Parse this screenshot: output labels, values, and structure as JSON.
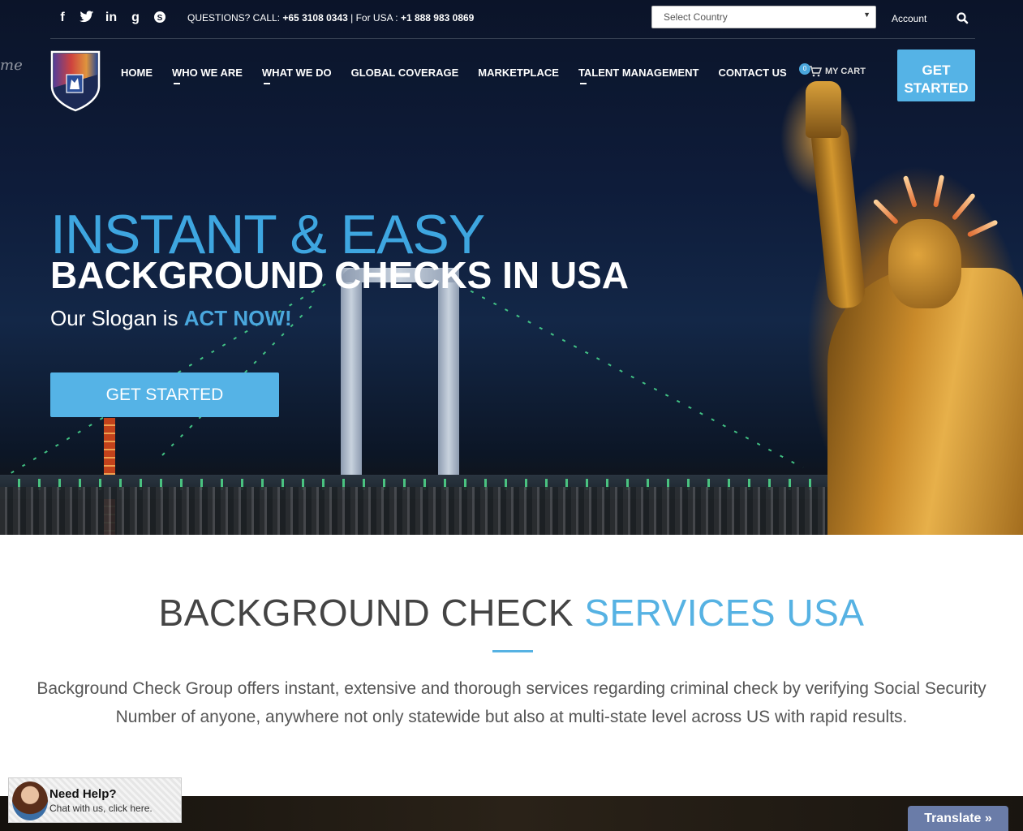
{
  "topbar": {
    "social_icons": [
      "facebook-icon",
      "twitter-icon",
      "linkedin-icon",
      "google-plus-icon",
      "skype-icon"
    ],
    "social_glyphs": [
      "f",
      "t",
      "in",
      "g",
      "S"
    ],
    "contact_prefix": "QUESTIONS? CALL: ",
    "contact_phone": "+65 3108 0343",
    "contact_mid": " | For USA : ",
    "contact_usa_phone": "+1 888 983 0869",
    "country_select": "Select Country",
    "account": "Account"
  },
  "nav": {
    "items": [
      "HOME",
      "WHO WE ARE",
      "WHAT WE DO",
      "GLOBAL COVERAGE",
      "MARKETPLACE",
      "TALENT MANAGEMENT",
      "CONTACT US"
    ],
    "cart_count": "0",
    "cart_label": "MY CART",
    "cta_line1": "GET",
    "cta_line2": "STARTED"
  },
  "hero": {
    "headline1": "INSTANT & EASY",
    "headline2": "BACKGROUND CHECKS IN USA",
    "slogan_prefix": "Our Slogan is ",
    "slogan_accent": "ACT NOW!",
    "button": "GET STARTED",
    "edge_text": "me"
  },
  "section": {
    "title_main": "BACKGROUND CHECK ",
    "title_accent": "SERVICES USA",
    "description": "Background Check Group offers instant, extensive and thorough services regarding criminal check by verifying Social Security Number of anyone, anywhere not only statewide but also at multi-state level across US with rapid results."
  },
  "chat": {
    "title": "Need Help?",
    "subtitle": "Chat with us, click here."
  },
  "translate": "Translate »",
  "colors": {
    "accent": "#55b3e6",
    "headline_blue": "#3ea6e0",
    "navy": "#0e1c3a"
  }
}
